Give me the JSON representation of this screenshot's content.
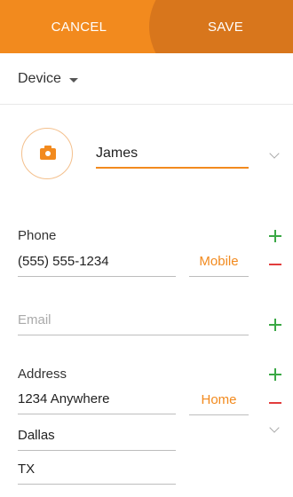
{
  "toolbar": {
    "cancel_label": "CANCEL",
    "save_label": "SAVE"
  },
  "storage": {
    "label": "Device"
  },
  "contact": {
    "name": "James"
  },
  "phone": {
    "section_label": "Phone",
    "number": "(555) 555-1234",
    "type": "Mobile"
  },
  "email": {
    "placeholder": "Email"
  },
  "address": {
    "section_label": "Address",
    "street": "1234 Anywhere",
    "city": "Dallas",
    "state": "TX",
    "type": "Home"
  },
  "colors": {
    "accent": "#f28a1e",
    "accent_dark": "#d8761c",
    "add": "#3aa845",
    "remove": "#e23c3c"
  },
  "icons": [
    "camera-icon",
    "dropdown-caret-icon",
    "chevron-down-icon",
    "plus-icon",
    "minus-icon"
  ]
}
